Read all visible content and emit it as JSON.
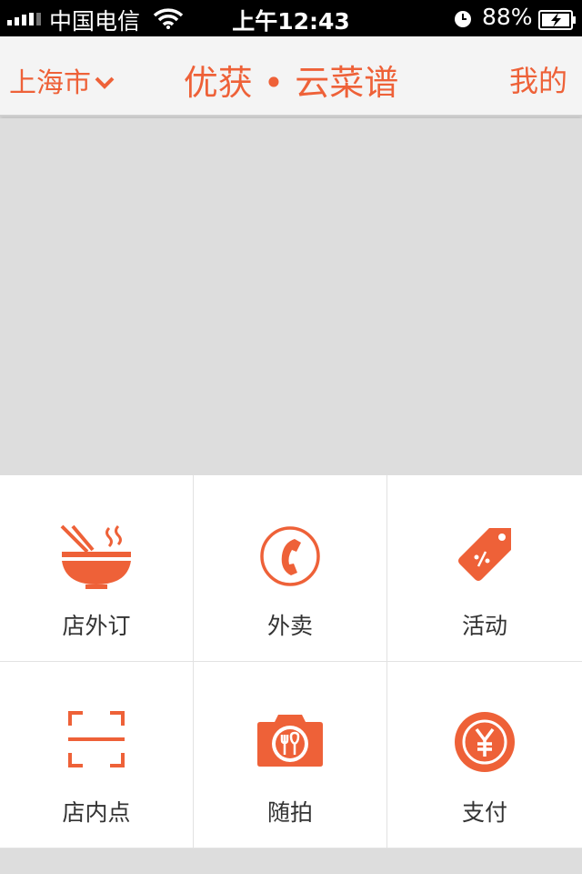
{
  "status_bar": {
    "carrier": "中国电信",
    "time": "上午12:43",
    "battery": "88%"
  },
  "nav": {
    "city": "上海市",
    "title": "优获 • 云菜谱",
    "mine": "我的"
  },
  "menu": {
    "items": [
      {
        "label": "店外订",
        "icon": "noodle-bowl-icon"
      },
      {
        "label": "外卖",
        "icon": "phone-circle-icon"
      },
      {
        "label": "活动",
        "icon": "price-tag-icon"
      },
      {
        "label": "店内点",
        "icon": "scan-frame-icon"
      },
      {
        "label": "随拍",
        "icon": "camera-icon"
      },
      {
        "label": "支付",
        "icon": "yuan-coin-icon"
      }
    ]
  },
  "colors": {
    "accent": "#ee6138",
    "status_bar_bg": "#000000",
    "nav_bg": "#f4f4f4",
    "banner_bg": "#dddddd"
  }
}
